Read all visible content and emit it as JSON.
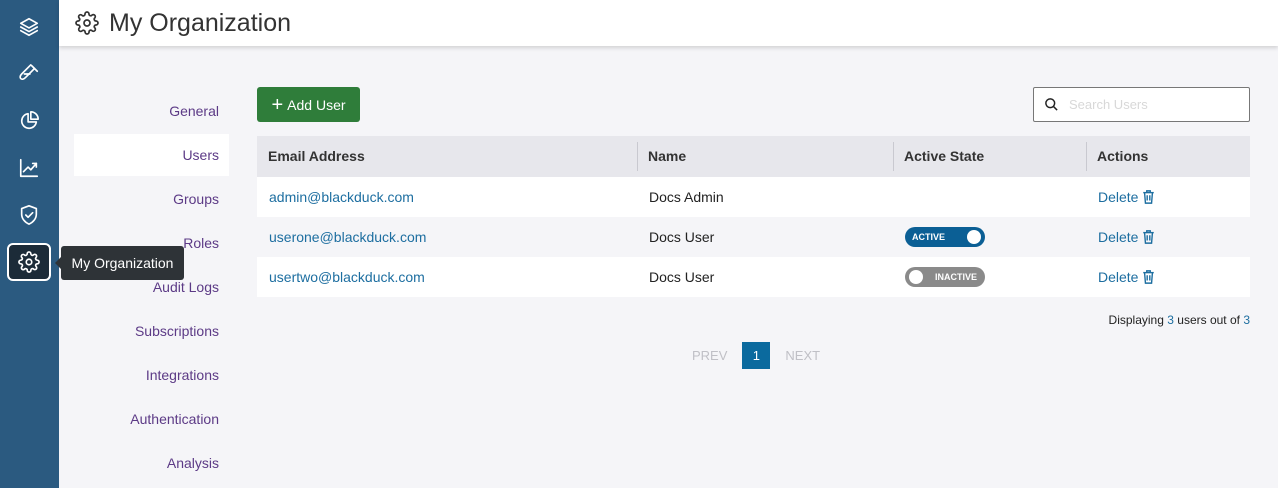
{
  "rail": {
    "items": [
      {
        "name": "projects",
        "icon": "layers-icon"
      },
      {
        "name": "components",
        "icon": "vial-icon"
      },
      {
        "name": "dashboard",
        "icon": "pie-chart-icon"
      },
      {
        "name": "reports",
        "icon": "trend-chart-icon"
      },
      {
        "name": "policies",
        "icon": "shield-check-icon"
      },
      {
        "name": "my-organization",
        "icon": "gear-icon",
        "active": true
      }
    ],
    "tooltip": "My Organization"
  },
  "header": {
    "title": "My Organization",
    "icon": "gear-icon"
  },
  "sidenav": {
    "items": [
      {
        "label": "General"
      },
      {
        "label": "Users",
        "active": true
      },
      {
        "label": "Groups"
      },
      {
        "label": "Roles"
      },
      {
        "label": "Audit Logs"
      },
      {
        "label": "Subscriptions"
      },
      {
        "label": "Integrations"
      },
      {
        "label": "Authentication"
      },
      {
        "label": "Analysis"
      }
    ]
  },
  "toolbar": {
    "add_user_label": "Add User",
    "search_placeholder": "Search Users"
  },
  "table": {
    "columns": [
      "Email Address",
      "Name",
      "Active State",
      "Actions"
    ],
    "rows": [
      {
        "email": "admin@blackduck.com",
        "name": "Docs Admin",
        "state": "",
        "action": "Delete"
      },
      {
        "email": "userone@blackduck.com",
        "name": "Docs User",
        "state": "ACTIVE",
        "action": "Delete"
      },
      {
        "email": "usertwo@blackduck.com",
        "name": "Docs User",
        "state": "INACTIVE",
        "action": "Delete"
      }
    ]
  },
  "summary": {
    "prefix": "Displaying",
    "shown": "3",
    "middle": "users out of",
    "total": "3"
  },
  "pagination": {
    "prev": "PREV",
    "current": "1",
    "next": "NEXT"
  },
  "colors": {
    "rail": "#2b5a80",
    "primary_button": "#2f7d3a",
    "link": "#1d6ea0",
    "toggle_active": "#0b5f95",
    "toggle_inactive": "#8a8a8a",
    "nav_text": "#5c3a86"
  }
}
